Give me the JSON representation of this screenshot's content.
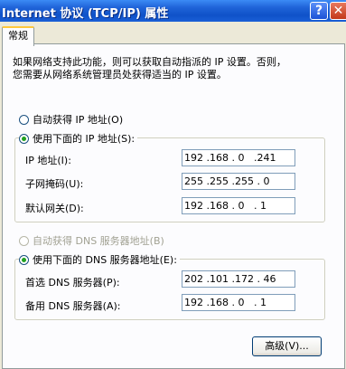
{
  "window": {
    "title": "Internet 协议 (TCP/IP) 属性",
    "help_glyph": "?",
    "close_glyph": "✕"
  },
  "tabs": [
    {
      "label": "常规",
      "selected": true
    }
  ],
  "intro": {
    "line1": "如果网络支持此功能，则可以获取自动指派的 IP 设置。否则，",
    "line2": "您需要从网络系统管理员处获得适当的 IP 设置。"
  },
  "ip_section": {
    "auto_label": "自动获得 IP 地址(O)",
    "auto_checked": false,
    "manual_label": "使用下面的 IP 地址(S):",
    "manual_checked": true,
    "fields": [
      {
        "label": "IP 地址(I):",
        "value": "192 .168 . 0   .241"
      },
      {
        "label": "子网掩码(U):",
        "value": "255 .255 .255 . 0"
      },
      {
        "label": "默认网关(D):",
        "value": "192 .168 . 0   . 1"
      }
    ]
  },
  "dns_section": {
    "auto_label": "自动获得 DNS 服务器地址(B)",
    "auto_checked": false,
    "auto_enabled": false,
    "manual_label": "使用下面的 DNS 服务器地址(E):",
    "manual_checked": true,
    "fields": [
      {
        "label": "首选 DNS 服务器(P):",
        "value": "202 .101 .172 . 46"
      },
      {
        "label": "备用 DNS 服务器(A):",
        "value": "192 .168 . 0   . 1"
      }
    ]
  },
  "advanced_button": {
    "label": "高级(V)..."
  }
}
